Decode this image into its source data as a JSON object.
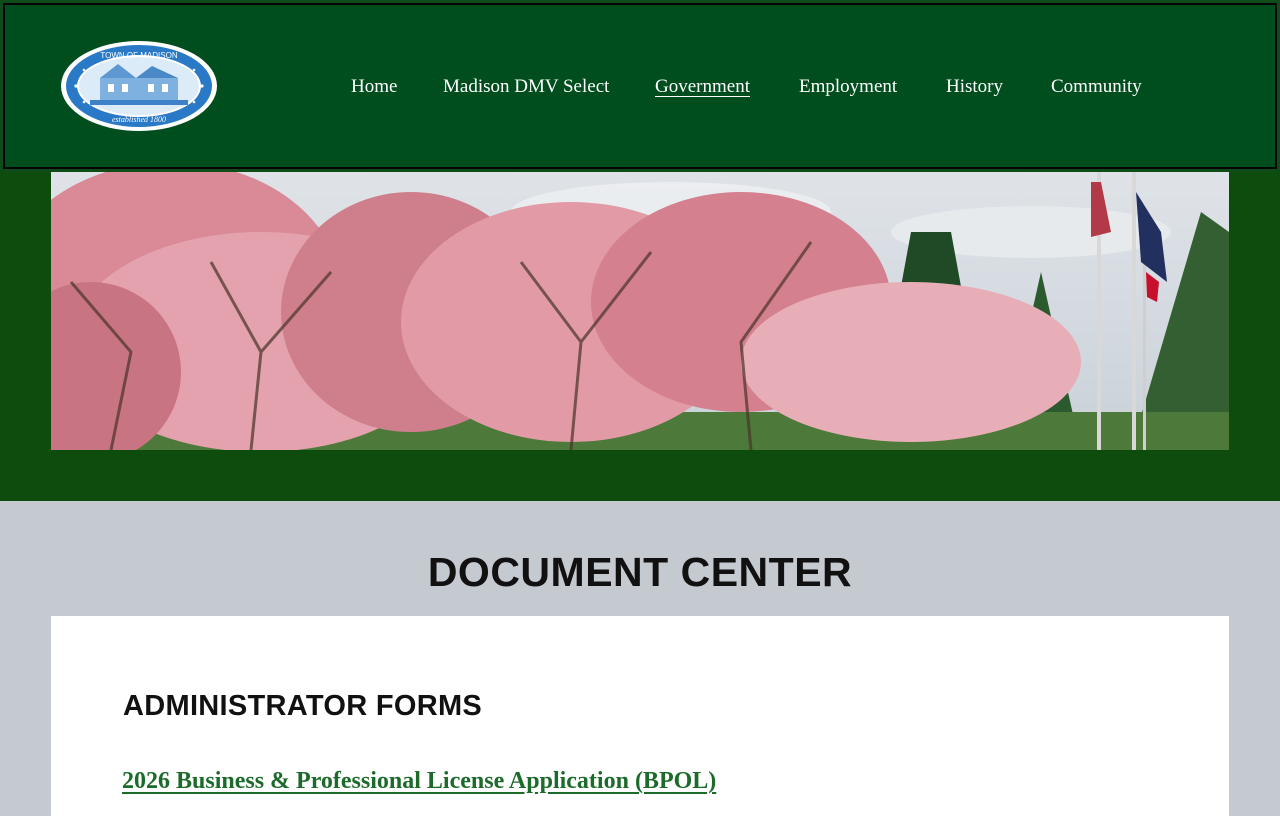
{
  "logo": {
    "ring_top_text": "TOWN OF MADISON",
    "ring_bottom_text": "established 1800",
    "color_ring": "#2a79c7",
    "color_fill": "#ffffff"
  },
  "nav": {
    "items": [
      {
        "label": "Home"
      },
      {
        "label": "Madison DMV Select"
      },
      {
        "label": "Government",
        "active": true
      },
      {
        "label": "Employment"
      },
      {
        "label": "History"
      },
      {
        "label": "Community"
      }
    ]
  },
  "colors": {
    "header_bg": "#004d1e",
    "band_bg": "#0e4c0e",
    "page_bg": "#c5cad0",
    "link": "#1d6b2b"
  },
  "page": {
    "title": "DOCUMENT CENTER"
  },
  "documents": {
    "section_title": "ADMINISTRATOR FORMS",
    "items": [
      {
        "label": "2026 Business & Professional License Application (BPOL)"
      }
    ]
  }
}
